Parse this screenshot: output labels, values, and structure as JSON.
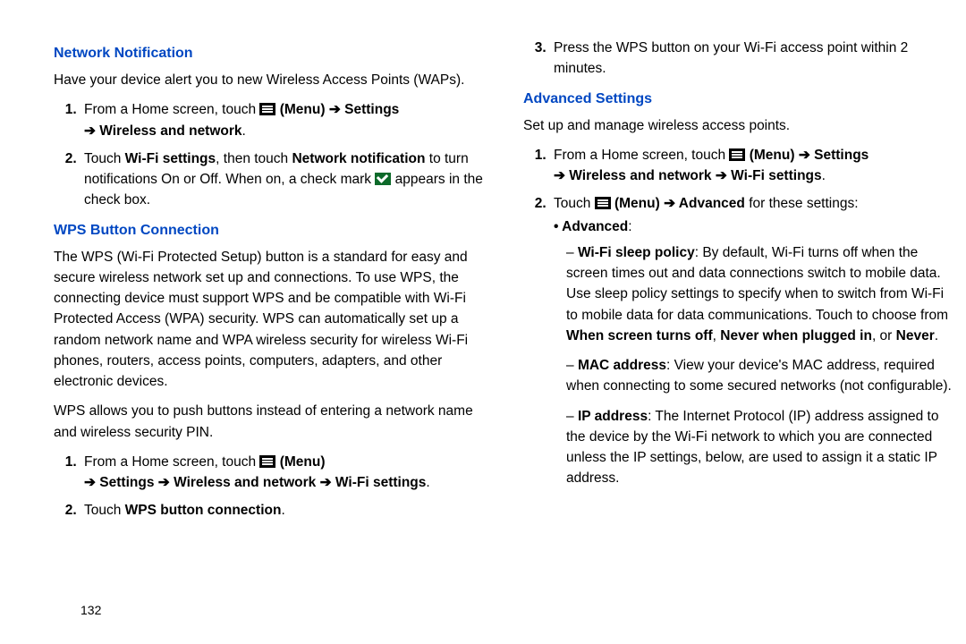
{
  "page_number": "132",
  "left": {
    "h1": "Network Notification",
    "p1": "Have your device alert you to new Wireless Access Points (WAPs).",
    "nn": {
      "s1a": "From a Home screen, touch ",
      "s1b": " (Menu) ",
      "s1c": " Settings ",
      "s1d": " Wireless and network",
      "dot": ".",
      "s2a": "Touch ",
      "s2b": "Wi-Fi settings",
      "s2c": ", then touch ",
      "s2d": "Network notification",
      "s2e": " to turn notifications On or Off. When on, a check mark ",
      "s2f": " appears in the check box."
    },
    "h2": "WPS Button Connection",
    "p2": "The WPS (Wi-Fi Protected Setup) button is a standard for easy and secure wireless network set up and connections. To use WPS, the connecting device must support WPS and be compatible with Wi-Fi Protected Access (WPA) security. WPS can automatically set up a random network name and WPA wireless security for wireless Wi-Fi phones, routers, access points, computers, adapters, and other electronic devices.",
    "p3": "WPS allows you to push buttons instead of entering a network name and wireless security PIN.",
    "wps": {
      "s1a": "From a Home screen, touch ",
      "s1b": " (Menu)",
      "s1c": " Settings ",
      "s1d": " Wireless and network ",
      "s1e": " Wi-Fi settings",
      "dot": ".",
      "s2a": "Touch ",
      "s2b": "WPS button connection",
      "s2c": "."
    }
  },
  "right": {
    "wps3a": "Press the WPS button on your Wi-Fi access point within 2 minutes.",
    "h3": "Advanced Settings",
    "p4": "Set up and manage wireless access points.",
    "adv": {
      "s1a": "From a Home screen, touch ",
      "s1b": " (Menu) ",
      "s1c": " Settings ",
      "s1d": " Wireless and network ",
      "s1e": " Wi-Fi settings",
      "dot": ".",
      "s2a": "Touch ",
      "s2b": " (Menu) ",
      "s2c": " Advanced",
      "s2d": " for these settings:",
      "bullet": "Advanced",
      "d1a": "Wi-Fi sleep policy",
      "d1b": ": By default, Wi-Fi turns off when the screen times out and data connections switch to mobile data. Use sleep policy settings to specify when to switch from Wi-Fi to mobile data for data communications. Touch to choose from ",
      "d1c": "When screen turns off",
      "d1d": ", ",
      "d1e": "Never when plugged in",
      "d1f": ", or ",
      "d1g": "Never",
      "d1h": ".",
      "d2a": "MAC address",
      "d2b": ": View your device's MAC address, required when connecting to some secured networks (not configurable).",
      "d3a": "IP address",
      "d3b": ": The Internet Protocol (IP) address assigned to the device by the Wi-Fi network to which you are connected unless the IP settings, below, are used to assign it a static IP address."
    }
  },
  "arrow": "➔"
}
